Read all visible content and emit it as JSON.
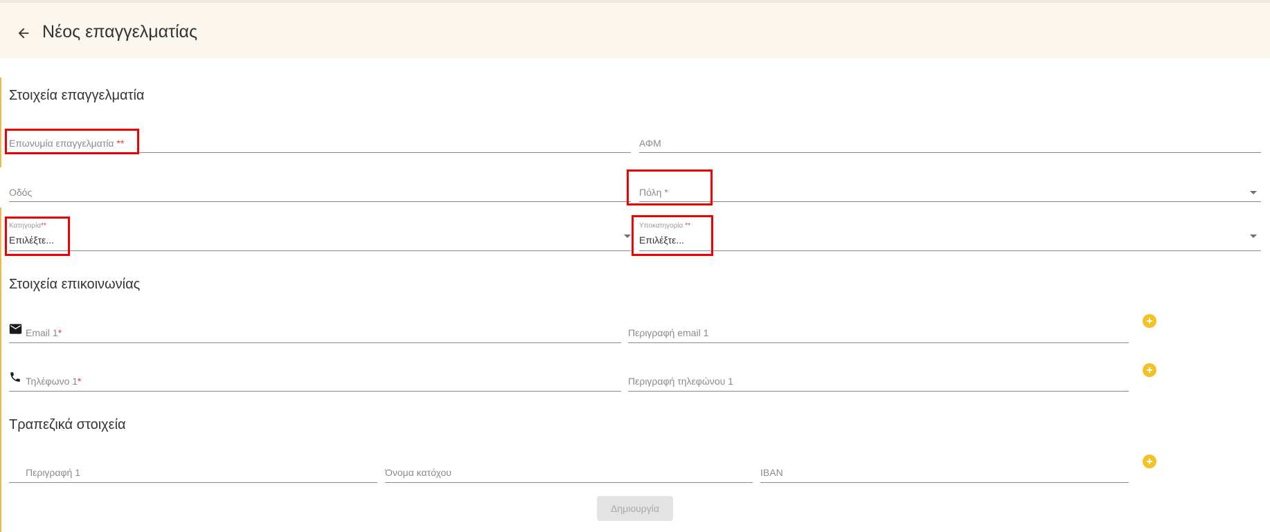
{
  "header": {
    "title": "Νέος επαγγελματίας"
  },
  "sections": {
    "professional": "Στοιχεία επαγγελματία",
    "contact": "Στοιχεία επικοινωνίας",
    "bank": "Τραπεζικά στοιχεία"
  },
  "fields": {
    "name": {
      "label": "Επωνυμία επαγγελματία",
      "required_marker": "**"
    },
    "afm": {
      "label": "ΑΦΜ"
    },
    "street": {
      "label": "Οδός"
    },
    "city": {
      "label": "Πόλη",
      "required_marker": "*"
    },
    "category": {
      "label": "Κατηγορία",
      "required_marker": "**",
      "value": "Επιλέξτε..."
    },
    "subcategory": {
      "label": "Υποκατηγορία",
      "required_marker": "**",
      "value": "Επιλέξτε..."
    },
    "email": {
      "label": "Email 1",
      "required_marker": "*"
    },
    "email_desc": {
      "label": "Περιγραφή email 1"
    },
    "phone": {
      "label": "Τηλέφωνο 1",
      "required_marker": "*"
    },
    "phone_desc": {
      "label": "Περιγραφή τηλεφώνου 1"
    },
    "bank_desc": {
      "label": "Περιγραφή 1"
    },
    "holder": {
      "label": "Όνομα κατόχου"
    },
    "iban": {
      "label": "IBAN"
    }
  },
  "buttons": {
    "submit": "Δημιουργία"
  },
  "icons": {
    "back": "arrow-left-icon",
    "email": "mail-icon",
    "phone": "phone-icon",
    "add": "plus-circle-icon"
  },
  "colors": {
    "header_bg": "#fbf6ee",
    "accent": "#f5c226",
    "required": "#e53935",
    "highlight": "#ee0000"
  }
}
